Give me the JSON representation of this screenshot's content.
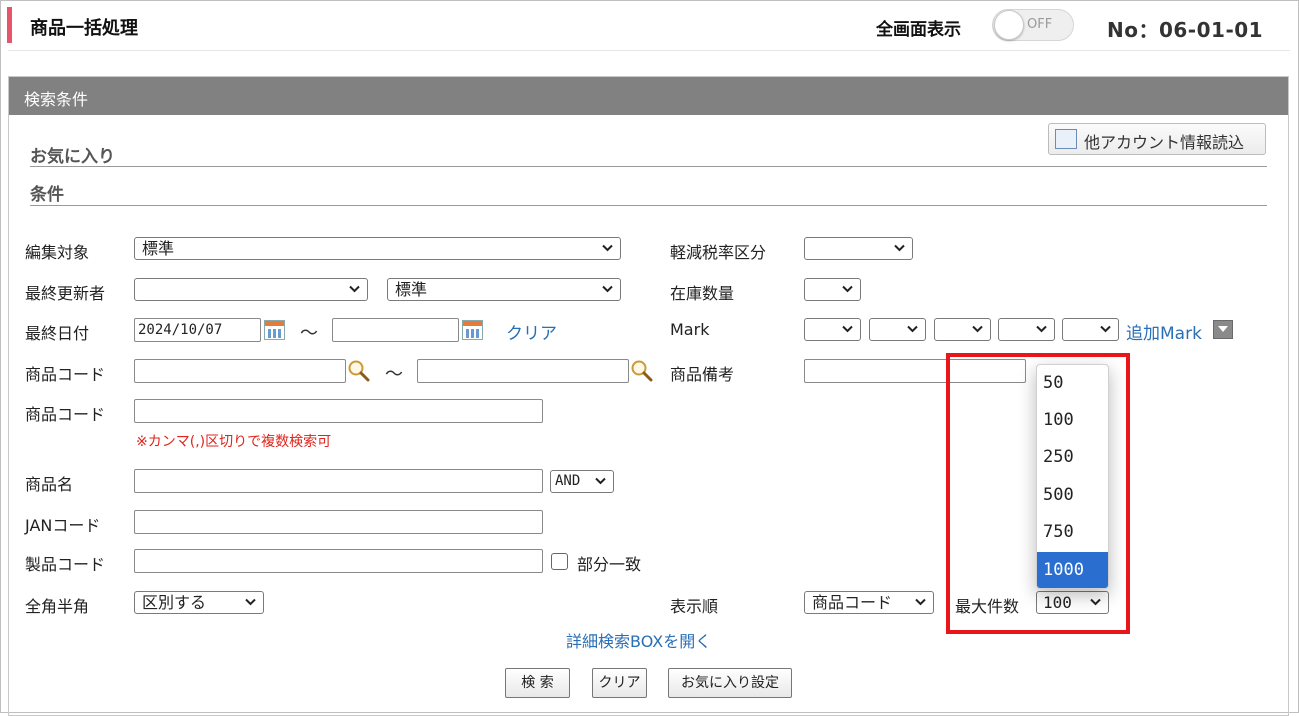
{
  "header": {
    "title": "商品一括処理",
    "fullscreen_label": "全画面表示",
    "toggle_text": "OFF",
    "screen_no": "No：06-01-01"
  },
  "panel": {
    "title": "検索条件",
    "favorites_heading": "お気に入り",
    "conditions_heading": "条件",
    "other_account_button": "他アカウント情報読込"
  },
  "form": {
    "edit_target": {
      "label": "編集対象",
      "value": "標準"
    },
    "last_updater": {
      "label": "最終更新者",
      "value": "",
      "second_value": "標準"
    },
    "last_date": {
      "label": "最終日付",
      "from": "2024/10/07",
      "to": "",
      "tilde": "～",
      "clear_link": "クリア"
    },
    "product_code_range": {
      "label": "商品コード",
      "from": "",
      "to": "",
      "tilde": "～"
    },
    "product_code_multi": {
      "label": "商品コード",
      "value": "",
      "note": "※カンマ(,)区切りで複数検索可"
    },
    "product_name": {
      "label": "商品名",
      "value": "",
      "operator": "AND"
    },
    "jan_code": {
      "label": "JANコード",
      "value": ""
    },
    "maker_code": {
      "label": "製品コード",
      "value": "",
      "partial_match_label": "部分一致"
    },
    "width_mode": {
      "label": "全角半角",
      "value": "区別する"
    },
    "reduced_tax": {
      "label": "軽減税率区分",
      "value": ""
    },
    "stock_qty": {
      "label": "在庫数量",
      "value": ""
    },
    "mark": {
      "label": "Mark",
      "values": [
        "",
        "",
        "",
        "",
        ""
      ],
      "add_link": "追加Mark"
    },
    "product_memo": {
      "label": "商品備考",
      "value": ""
    },
    "sort_order": {
      "label": "表示順",
      "value": "商品コード"
    },
    "max_count": {
      "label": "最大件数",
      "value": "100",
      "options": [
        "50",
        "100",
        "250",
        "500",
        "750",
        "1000"
      ],
      "highlighted_option": "1000"
    },
    "detail_link": "詳細検索BOXを開く"
  },
  "actions": {
    "search": "検 索",
    "clear": "クリア",
    "favorite_settings": "お気に入り設定"
  },
  "colors": {
    "accent": "#e8556b",
    "panel_header": "#818181",
    "link": "#2a6fb5",
    "note": "#e0241c",
    "selected_option": "#2a6fcf",
    "annotation_box": "#e8161b"
  }
}
